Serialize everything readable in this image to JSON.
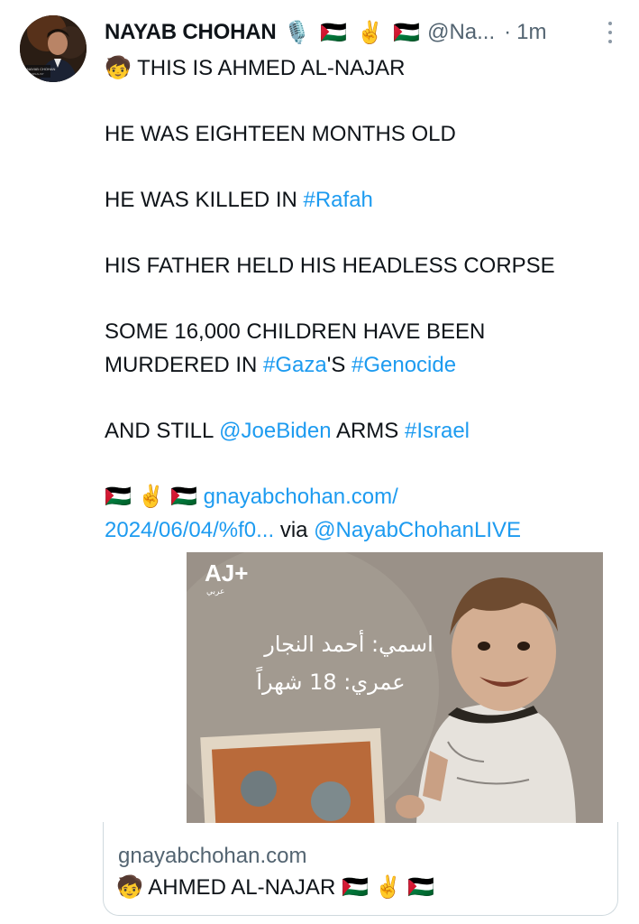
{
  "tweet": {
    "author": {
      "name": "NAYAB CHOHAN",
      "badges": "🎙️ 🇵🇸 ✌️ 🇵🇸",
      "handle": "@Na...",
      "separator": "·",
      "time": "1m",
      "avatar_caption": "NAYAB CHOHAN\nJOURNALIST"
    },
    "lines": {
      "l1": "🧒 THIS IS AHMED AL-NAJAR",
      "l2": "HE WAS EIGHTEEN MONTHS OLD",
      "l3_prefix": "HE WAS KILLED IN ",
      "l3_tag": "#Rafah",
      "l4": "HIS FATHER HELD HIS HEADLESS CORPSE",
      "l5a": "SOME 16,000 CHILDREN HAVE BEEN",
      "l5b_prefix": "MURDERED IN ",
      "l5b_tag1": "#Gaza",
      "l5b_mid": "'S ",
      "l5b_tag2": "#Genocide",
      "l6_prefix": "AND STILL ",
      "l6_mention": "@JoeBiden",
      "l6_mid": " ARMS ",
      "l6_tag": "#Israel",
      "l7_emoji": "🇵🇸 ✌️ 🇵🇸 ",
      "l7_link": "gnayabchohan.com/",
      "l8_link": "2024/06/04/%f0...",
      "l8_via": " via ",
      "l8_mention": "@NayabChohanLIVE"
    },
    "media": {
      "logo": "AJ+",
      "logo_sub": "عربي",
      "arabic_name": "اسمي: أحمد النجار",
      "arabic_age": "عمري: 18 شهراً"
    },
    "card": {
      "domain": "gnayabchohan.com",
      "title": "🧒 AHMED AL-NAJAR 🇵🇸 ✌️ 🇵🇸"
    }
  }
}
